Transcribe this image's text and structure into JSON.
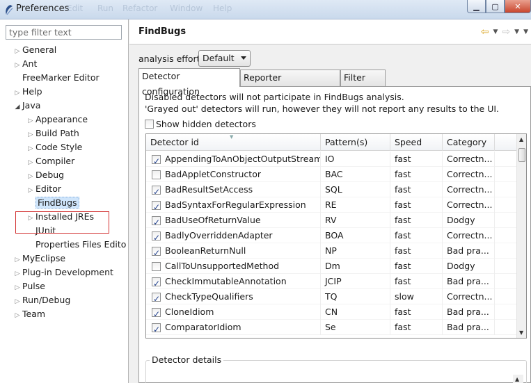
{
  "window": {
    "title": "Preferences"
  },
  "ghost_menu": [
    "Edit",
    "Run",
    "Refactor",
    "Window",
    "Help"
  ],
  "filter": {
    "placeholder": "type filter text"
  },
  "tree": [
    {
      "label": "General",
      "toggle": "▷"
    },
    {
      "label": "Ant",
      "toggle": "▷"
    },
    {
      "label": "FreeMarker Editor",
      "toggle": ""
    },
    {
      "label": "Help",
      "toggle": "▷"
    },
    {
      "label": "Java",
      "toggle": "◢"
    },
    {
      "label": "Appearance",
      "toggle": "▷"
    },
    {
      "label": "Build Path",
      "toggle": "▷"
    },
    {
      "label": "Code Style",
      "toggle": "▷"
    },
    {
      "label": "Compiler",
      "toggle": "▷"
    },
    {
      "label": "Debug",
      "toggle": "▷"
    },
    {
      "label": "Editor",
      "toggle": "▷"
    },
    {
      "label": "FindBugs",
      "toggle": ""
    },
    {
      "label": "Installed JREs",
      "toggle": "▷"
    },
    {
      "label": "JUnit",
      "toggle": ""
    },
    {
      "label": "Properties Files Edito",
      "toggle": ""
    },
    {
      "label": "MyEclipse",
      "toggle": "▷"
    },
    {
      "label": "Plug-in Development",
      "toggle": "▷"
    },
    {
      "label": "Pulse",
      "toggle": "▷"
    },
    {
      "label": "Run/Debug",
      "toggle": "▷"
    },
    {
      "label": "Team",
      "toggle": "▷"
    }
  ],
  "page": {
    "title": "FindBugs"
  },
  "effort": {
    "label": "analysis effort",
    "value": "Default"
  },
  "tabs": [
    "Detector configuration",
    "Reporter configuration",
    "Filter files"
  ],
  "description": [
    "Disabled detectors will not participate in FindBugs analysis.",
    "'Grayed out' detectors will run, however they will not report any results to the UI."
  ],
  "show_hidden": {
    "label": "Show hidden detectors",
    "checked": false
  },
  "table": {
    "columns": [
      "Detector id",
      "Pattern(s)",
      "Speed",
      "Category"
    ],
    "rows": [
      {
        "id": "AppendingToAnObjectOutputStream",
        "pattern": "IO",
        "speed": "fast",
        "category": "Correctn...",
        "checked": true
      },
      {
        "id": "BadAppletConstructor",
        "pattern": "BAC",
        "speed": "fast",
        "category": "Correctn...",
        "checked": false
      },
      {
        "id": "BadResultSetAccess",
        "pattern": "SQL",
        "speed": "fast",
        "category": "Correctn...",
        "checked": true
      },
      {
        "id": "BadSyntaxForRegularExpression",
        "pattern": "RE",
        "speed": "fast",
        "category": "Correctn...",
        "checked": true
      },
      {
        "id": "BadUseOfReturnValue",
        "pattern": "RV",
        "speed": "fast",
        "category": "Dodgy",
        "checked": true
      },
      {
        "id": "BadlyOverriddenAdapter",
        "pattern": "BOA",
        "speed": "fast",
        "category": "Correctn...",
        "checked": true
      },
      {
        "id": "BooleanReturnNull",
        "pattern": "NP",
        "speed": "fast",
        "category": "Bad pra...",
        "checked": true
      },
      {
        "id": "CallToUnsupportedMethod",
        "pattern": "Dm",
        "speed": "fast",
        "category": "Dodgy",
        "checked": false
      },
      {
        "id": "CheckImmutableAnnotation",
        "pattern": "JCIP",
        "speed": "fast",
        "category": "Bad pra...",
        "checked": true
      },
      {
        "id": "CheckTypeQualifiers",
        "pattern": "TQ",
        "speed": "slow",
        "category": "Correctn...",
        "checked": true
      },
      {
        "id": "CloneIdiom",
        "pattern": "CN",
        "speed": "fast",
        "category": "Bad pra...",
        "checked": true
      },
      {
        "id": "ComparatorIdiom",
        "pattern": "Se",
        "speed": "fast",
        "category": "Bad pra...",
        "checked": true
      }
    ]
  },
  "details": {
    "label": "Detector details"
  }
}
